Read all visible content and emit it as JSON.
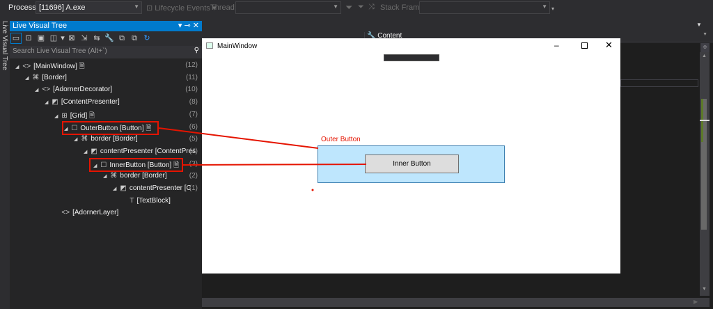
{
  "toolbar": {
    "process_label": "Process:",
    "process_value": "[11696] A.exe",
    "lifecycle_label": "Lifecycle Events",
    "thread_label": "Thread:",
    "stack_frame_label": "Stack Frame:"
  },
  "side_tab": "Live Visual Tree",
  "panel": {
    "title": "Live Visual Tree",
    "search_placeholder": "Search Live Visual Tree (Alt+`)",
    "tree": [
      {
        "label": "[MainWindow]",
        "count": "(12)",
        "icon": "<>",
        "level": 0,
        "arrow": true,
        "doc": true
      },
      {
        "label": "[Border]",
        "count": "(11)",
        "icon": "⌘",
        "level": 1,
        "arrow": true,
        "doc": false
      },
      {
        "label": "[AdornerDecorator]",
        "count": "(10)",
        "icon": "<>",
        "level": 2,
        "arrow": true,
        "doc": false
      },
      {
        "label": "[ContentPresenter]",
        "count": "(8)",
        "icon": "◩",
        "level": 3,
        "arrow": true,
        "doc": false
      },
      {
        "label": "[Grid]",
        "count": "(7)",
        "icon": "⊞",
        "level": 4,
        "arrow": true,
        "doc": true
      },
      {
        "label": "OuterButton [Button]",
        "count": "(6)",
        "icon": "☐",
        "level": 5,
        "arrow": true,
        "doc": true
      },
      {
        "label": "border [Border]",
        "count": "(5)",
        "icon": "⌘",
        "level": 6,
        "arrow": true,
        "doc": false
      },
      {
        "label": "contentPresenter [ContentPres",
        "count": "(4)",
        "icon": "◩",
        "level": 7,
        "arrow": true,
        "doc": false
      },
      {
        "label": "InnerButton [Button]",
        "count": "(3)",
        "icon": "☐",
        "level": 8,
        "arrow": true,
        "doc": true
      },
      {
        "label": "border [Border]",
        "count": "(2)",
        "icon": "⌘",
        "level": 9,
        "arrow": true,
        "doc": false
      },
      {
        "label": "contentPresenter [C",
        "count": "(1)",
        "icon": "◩",
        "level": 10,
        "arrow": true,
        "doc": false
      },
      {
        "label": "[TextBlock]",
        "count": "",
        "icon": "T",
        "level": 11,
        "arrow": false,
        "doc": false
      },
      {
        "label": "[AdornerLayer]",
        "count": "",
        "icon": "<>",
        "level": 4,
        "arrow": false,
        "doc": false
      }
    ]
  },
  "editor": {
    "dropdown_value": "Content"
  },
  "app_window": {
    "title": "MainWindow",
    "outer_label": "Outer Button",
    "inner_button": "Inner Button"
  },
  "colors": {
    "accent": "#007acc",
    "highlight": "#e51400",
    "outer_bg": "#bee6fd"
  }
}
